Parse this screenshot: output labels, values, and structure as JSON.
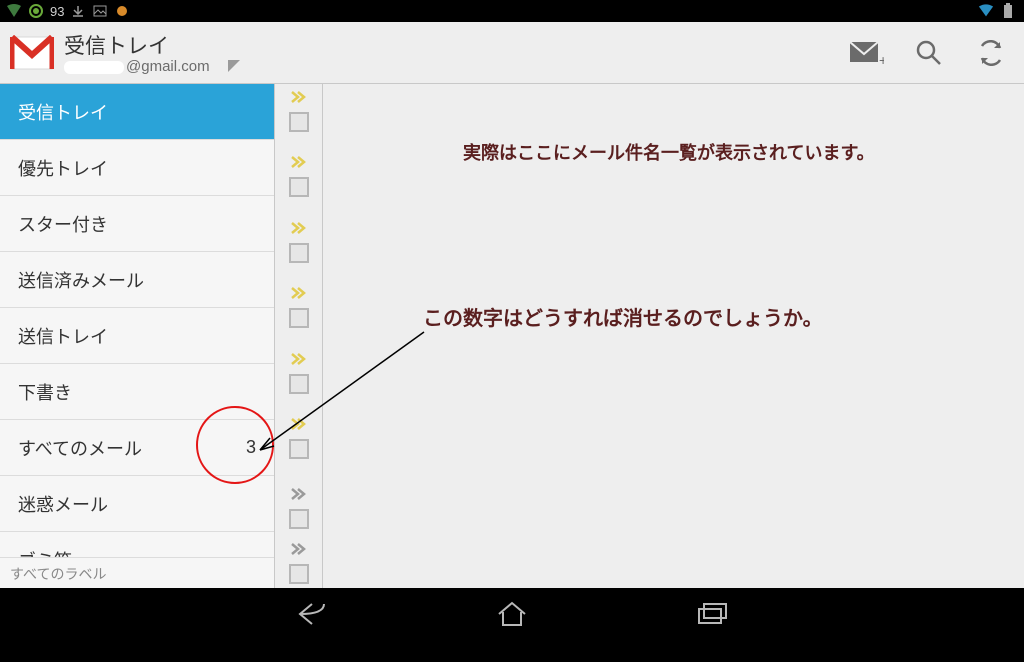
{
  "status": {
    "battery": "93"
  },
  "appbar": {
    "title": "受信トレイ",
    "account_suffix": "@gmail.com"
  },
  "toolbar": {
    "compose": "compose",
    "search": "search",
    "refresh": "refresh"
  },
  "sidebar": {
    "items": [
      {
        "label": "受信トレイ",
        "count": "",
        "selected": true
      },
      {
        "label": "優先トレイ",
        "count": "",
        "selected": false
      },
      {
        "label": "スター付き",
        "count": "",
        "selected": false
      },
      {
        "label": "送信済みメール",
        "count": "",
        "selected": false
      },
      {
        "label": "送信トレイ",
        "count": "",
        "selected": false
      },
      {
        "label": "下書き",
        "count": "",
        "selected": false
      },
      {
        "label": "すべてのメール",
        "count": "3",
        "selected": false
      },
      {
        "label": "迷惑メール",
        "count": "",
        "selected": false
      },
      {
        "label": "ゴミ箱",
        "count": "",
        "selected": false
      }
    ],
    "all_labels": "すべてのラベル"
  },
  "annotations": {
    "text1": "実際はここにメール件名一覧が表示されています。",
    "text2": "この数字はどうすれば消せるのでしょうか。"
  }
}
